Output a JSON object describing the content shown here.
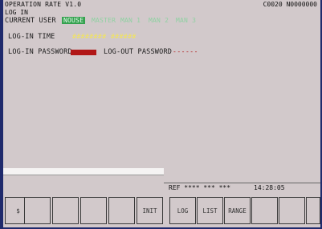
{
  "header": {
    "title": "OPERATION RATE V1.0",
    "subtitle": "LOG IN",
    "code": "C0020 N0000000"
  },
  "login": {
    "current_user_label": "CURRENT USER",
    "users": [
      "NOUSE",
      "MASTER",
      "MAN 1",
      "MAN 2",
      "MAN 3"
    ],
    "selected_user": "NOUSE",
    "login_time_label": "LOG-IN TIME",
    "login_time_value": "########  ######",
    "login_password_label": "LOG-IN PASSWORD",
    "logout_password_label": "LOG-OUT PASSWORD",
    "logout_password_value": "------"
  },
  "status": {
    "ref": "REF  **** *** ***",
    "time": "14:28:05"
  },
  "softkeys": {
    "k1": "$",
    "k6": "INIT",
    "k7": "LOG",
    "k8": "LIST",
    "k9": "RANGE"
  }
}
